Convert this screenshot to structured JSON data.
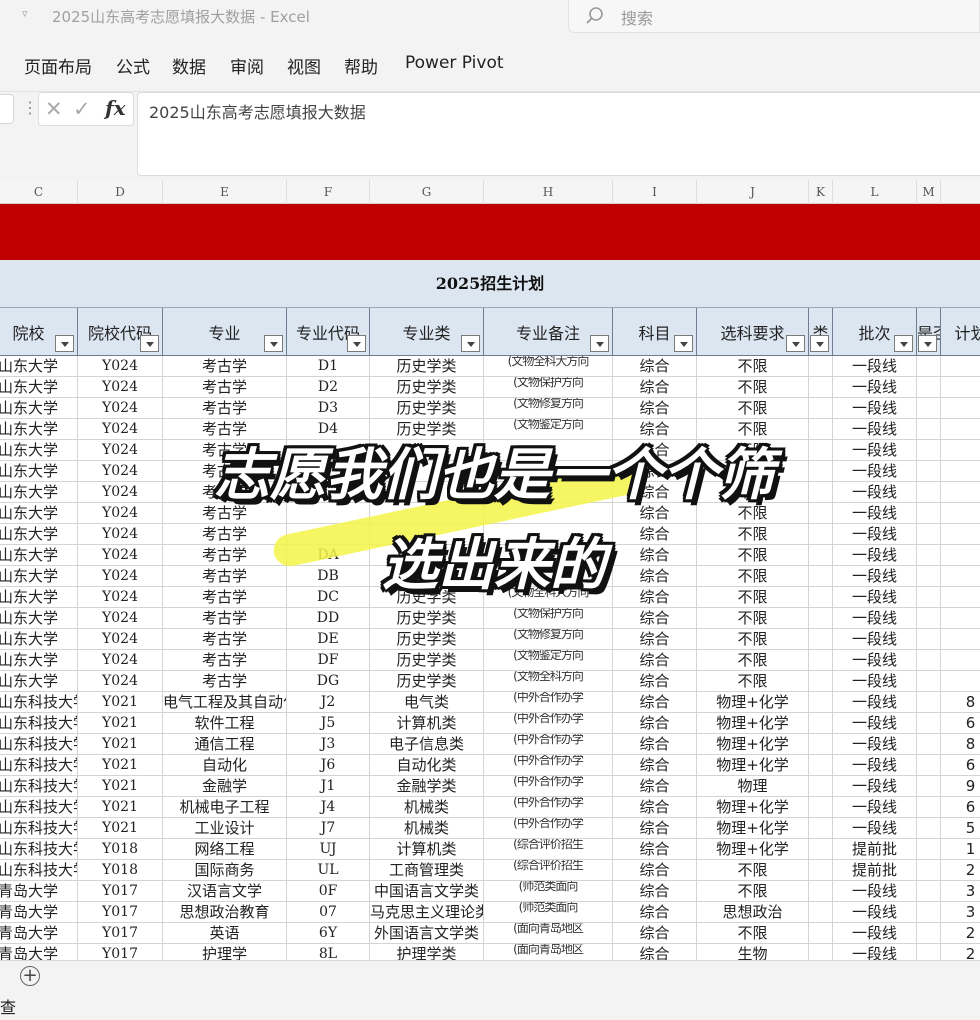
{
  "window": {
    "title": "2025山东高考志愿填报大数据  -  Excel",
    "quick_access": "▿",
    "search_placeholder": "搜索"
  },
  "ribbon": {
    "tabs": [
      {
        "label": "页面布局"
      },
      {
        "label": "公式"
      },
      {
        "label": "数据"
      },
      {
        "label": "审阅"
      },
      {
        "label": "视图"
      },
      {
        "label": "帮助"
      },
      {
        "label": "Power Pivot"
      }
    ]
  },
  "formula_bar": {
    "fx_label": "fx",
    "content": "2025山东高考志愿填报大数据"
  },
  "column_letters": [
    "C",
    "D",
    "E",
    "F",
    "G",
    "H",
    "I",
    "J",
    "K",
    "L",
    "M"
  ],
  "sheet": {
    "plan_title": "2025招生计划",
    "headers": [
      "院校",
      "院校代码",
      "专业",
      "专业代码",
      "专业类",
      "专业备注",
      "科目",
      "选科要求",
      "类",
      "批次",
      "是否",
      "计划"
    ],
    "rows": [
      [
        "山东大学",
        "Y024",
        "考古学",
        "D1",
        "历史学类",
        "(文物全科大方向",
        "综合",
        "不限",
        "",
        "一段线",
        "",
        ""
      ],
      [
        "山东大学",
        "Y024",
        "考古学",
        "D2",
        "历史学类",
        "(文物保护方向",
        "综合",
        "不限",
        "",
        "一段线",
        "",
        ""
      ],
      [
        "山东大学",
        "Y024",
        "考古学",
        "D3",
        "历史学类",
        "(文物修复方向",
        "综合",
        "不限",
        "",
        "一段线",
        "",
        ""
      ],
      [
        "山东大学",
        "Y024",
        "考古学",
        "D4",
        "历史学类",
        "(文物鉴定方向",
        "综合",
        "不限",
        "",
        "一段线",
        "",
        ""
      ],
      [
        "山东大学",
        "Y024",
        "考古学",
        "",
        "",
        "",
        "综合",
        "不限",
        "",
        "一段线",
        "",
        ""
      ],
      [
        "山东大学",
        "Y024",
        "考古学",
        "",
        "",
        "",
        "综合",
        "不限",
        "",
        "一段线",
        "",
        ""
      ],
      [
        "山东大学",
        "Y024",
        "考古学",
        "",
        "",
        "",
        "综合",
        "不限",
        "",
        "一段线",
        "",
        ""
      ],
      [
        "山东大学",
        "Y024",
        "考古学",
        "",
        "",
        "",
        "综合",
        "不限",
        "",
        "一段线",
        "",
        ""
      ],
      [
        "山东大学",
        "Y024",
        "考古学",
        "",
        "",
        "",
        "综合",
        "不限",
        "",
        "一段线",
        "",
        ""
      ],
      [
        "山东大学",
        "Y024",
        "考古学",
        "DA",
        "",
        "",
        "综合",
        "不限",
        "",
        "一段线",
        "",
        ""
      ],
      [
        "山东大学",
        "Y024",
        "考古学",
        "DB",
        "",
        "",
        "综合",
        "不限",
        "",
        "一段线",
        "",
        ""
      ],
      [
        "山东大学",
        "Y024",
        "考古学",
        "DC",
        "历史学类",
        "(文物全科大方向",
        "综合",
        "不限",
        "",
        "一段线",
        "",
        ""
      ],
      [
        "山东大学",
        "Y024",
        "考古学",
        "DD",
        "历史学类",
        "(文物保护方向",
        "综合",
        "不限",
        "",
        "一段线",
        "",
        ""
      ],
      [
        "山东大学",
        "Y024",
        "考古学",
        "DE",
        "历史学类",
        "(文物修复方向",
        "综合",
        "不限",
        "",
        "一段线",
        "",
        ""
      ],
      [
        "山东大学",
        "Y024",
        "考古学",
        "DF",
        "历史学类",
        "(文物鉴定方向",
        "综合",
        "不限",
        "",
        "一段线",
        "",
        ""
      ],
      [
        "山东大学",
        "Y024",
        "考古学",
        "DG",
        "历史学类",
        "(文物全科方向",
        "综合",
        "不限",
        "",
        "一段线",
        "",
        ""
      ],
      [
        "山东科技大学",
        "Y021",
        "电气工程及其自动化",
        "J2",
        "电气类",
        "(中外合作办学",
        "综合",
        "物理+化学",
        "",
        "一段线",
        "",
        "8"
      ],
      [
        "山东科技大学",
        "Y021",
        "软件工程",
        "J5",
        "计算机类",
        "(中外合作办学",
        "综合",
        "物理+化学",
        "",
        "一段线",
        "",
        "6"
      ],
      [
        "山东科技大学",
        "Y021",
        "通信工程",
        "J3",
        "电子信息类",
        "(中外合作办学",
        "综合",
        "物理+化学",
        "",
        "一段线",
        "",
        "8"
      ],
      [
        "山东科技大学",
        "Y021",
        "自动化",
        "J6",
        "自动化类",
        "(中外合作办学",
        "综合",
        "物理+化学",
        "",
        "一段线",
        "",
        "6"
      ],
      [
        "山东科技大学",
        "Y021",
        "金融学",
        "J1",
        "金融学类",
        "(中外合作办学",
        "综合",
        "物理",
        "",
        "一段线",
        "",
        "9"
      ],
      [
        "山东科技大学",
        "Y021",
        "机械电子工程",
        "J4",
        "机械类",
        "(中外合作办学",
        "综合",
        "物理+化学",
        "",
        "一段线",
        "",
        "6"
      ],
      [
        "山东科技大学",
        "Y021",
        "工业设计",
        "J7",
        "机械类",
        "(中外合作办学",
        "综合",
        "物理+化学",
        "",
        "一段线",
        "",
        "5"
      ],
      [
        "山东科技大学",
        "Y018",
        "网络工程",
        "UJ",
        "计算机类",
        "(综合评价招生",
        "综合",
        "物理+化学",
        "",
        "提前批",
        "",
        "1"
      ],
      [
        "山东科技大学",
        "Y018",
        "国际商务",
        "UL",
        "工商管理类",
        "(综合评价招生",
        "综合",
        "不限",
        "",
        "提前批",
        "",
        "2"
      ],
      [
        "青岛大学",
        "Y017",
        "汉语言文学",
        "0F",
        "中国语言文学类",
        "(师范类面向",
        "综合",
        "不限",
        "",
        "一段线",
        "",
        "3"
      ],
      [
        "青岛大学",
        "Y017",
        "思想政治教育",
        "07",
        "马克思主义理论类",
        "(师范类面向",
        "综合",
        "思想政治",
        "",
        "一段线",
        "",
        "3"
      ],
      [
        "青岛大学",
        "Y017",
        "英语",
        "6Y",
        "外国语言文学类",
        "(面向青岛地区",
        "综合",
        "不限",
        "",
        "一段线",
        "",
        "2"
      ],
      [
        "青岛大学",
        "Y017",
        "护理学",
        "8L",
        "护理学类",
        "(面向青岛地区",
        "综合",
        "生物",
        "",
        "一段线",
        "",
        "2"
      ]
    ]
  },
  "sheet_tabs": {
    "add_label": "+"
  },
  "status": {
    "text": "查"
  },
  "overlay": {
    "line1": "志愿我们也是一个个筛",
    "line2": "选出来的"
  }
}
